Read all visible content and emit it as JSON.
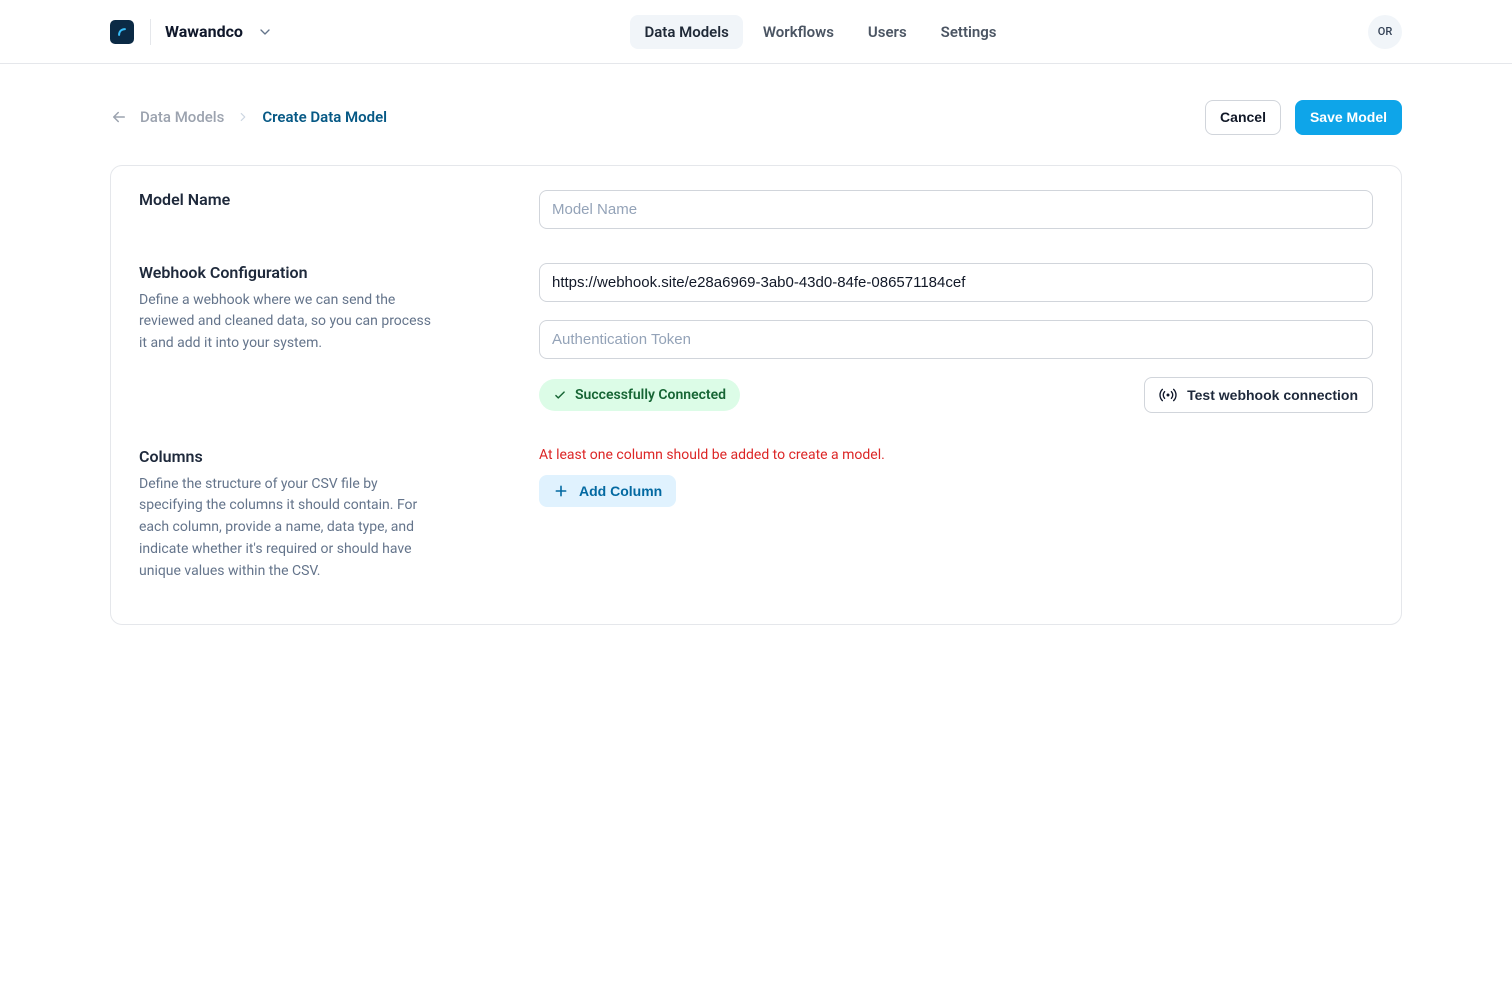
{
  "header": {
    "brand": "Wawandco",
    "nav": [
      {
        "label": "Data Models",
        "active": true
      },
      {
        "label": "Workflows",
        "active": false
      },
      {
        "label": "Users",
        "active": false
      },
      {
        "label": "Settings",
        "active": false
      }
    ],
    "avatar_initials": "OR"
  },
  "breadcrumb": {
    "back": "Data Models",
    "current": "Create Data Model"
  },
  "actions": {
    "cancel": "Cancel",
    "save": "Save Model"
  },
  "sections": {
    "model_name": {
      "title": "Model Name",
      "placeholder": "Model Name",
      "value": ""
    },
    "webhook": {
      "title": "Webhook Configuration",
      "description": "Define a webhook where we can send the reviewed and cleaned data, so you can process it and add it into your system.",
      "url_value": "https://webhook.site/e28a6969-3ab0-43d0-84fe-086571184cef",
      "auth_placeholder": "Authentication Token",
      "auth_value": "",
      "status_label": "Successfully Connected",
      "test_button": "Test webhook connection"
    },
    "columns": {
      "title": "Columns",
      "description": "Define the structure of your CSV file by specifying the columns it should contain. For each column, provide a name, data type, and indicate whether it's required or should have unique values within the CSV.",
      "error": "At least one column should be added to create a model.",
      "add_label": "Add Column"
    }
  }
}
